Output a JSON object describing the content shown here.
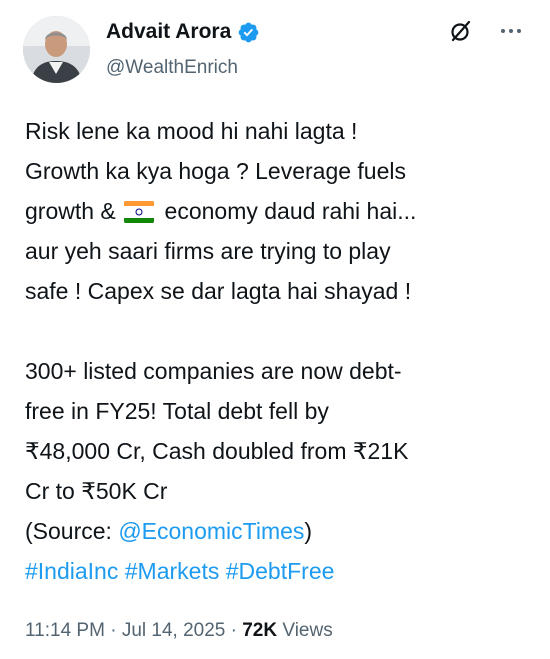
{
  "author": {
    "name": "Advait Arora",
    "handle": "@WealthEnrich",
    "verified_color": "#1d9bf0"
  },
  "icons": {
    "verified": "verified-badge-icon",
    "grok": "grok-icon",
    "more": "more-options-icon",
    "flag": "india-flag-icon"
  },
  "tweet": {
    "para1": {
      "l1": "Risk lene ka mood hi nahi lagta !",
      "l2": "Growth ka kya hoga ? Leverage fuels",
      "l3_pre": "growth & ",
      "l3_post": " economy daud rahi hai...",
      "l4": "aur yeh saari firms are trying to play",
      "l5": "safe ! Capex se dar lagta hai shayad !"
    },
    "para2": {
      "l1": "300+ listed companies are now debt-",
      "l2": "free in FY25! Total debt fell by",
      "l3": "₹48,000 Cr, Cash doubled from ₹21K",
      "l4": "Cr to ₹50K Cr",
      "l5_pre": "(Source: ",
      "l5_mention": "@EconomicTimes",
      "l5_post": ")"
    },
    "hashtags": [
      "#IndiaInc",
      "#Markets",
      "#DebtFree"
    ]
  },
  "meta": {
    "time": "11:14 PM",
    "date": "Jul 14, 2025",
    "separator": " · ",
    "views_count": "72K",
    "views_label": " Views"
  },
  "colors": {
    "link": "#1d9bf0",
    "secondary_text": "#536471",
    "primary_text": "#0f1419"
  }
}
